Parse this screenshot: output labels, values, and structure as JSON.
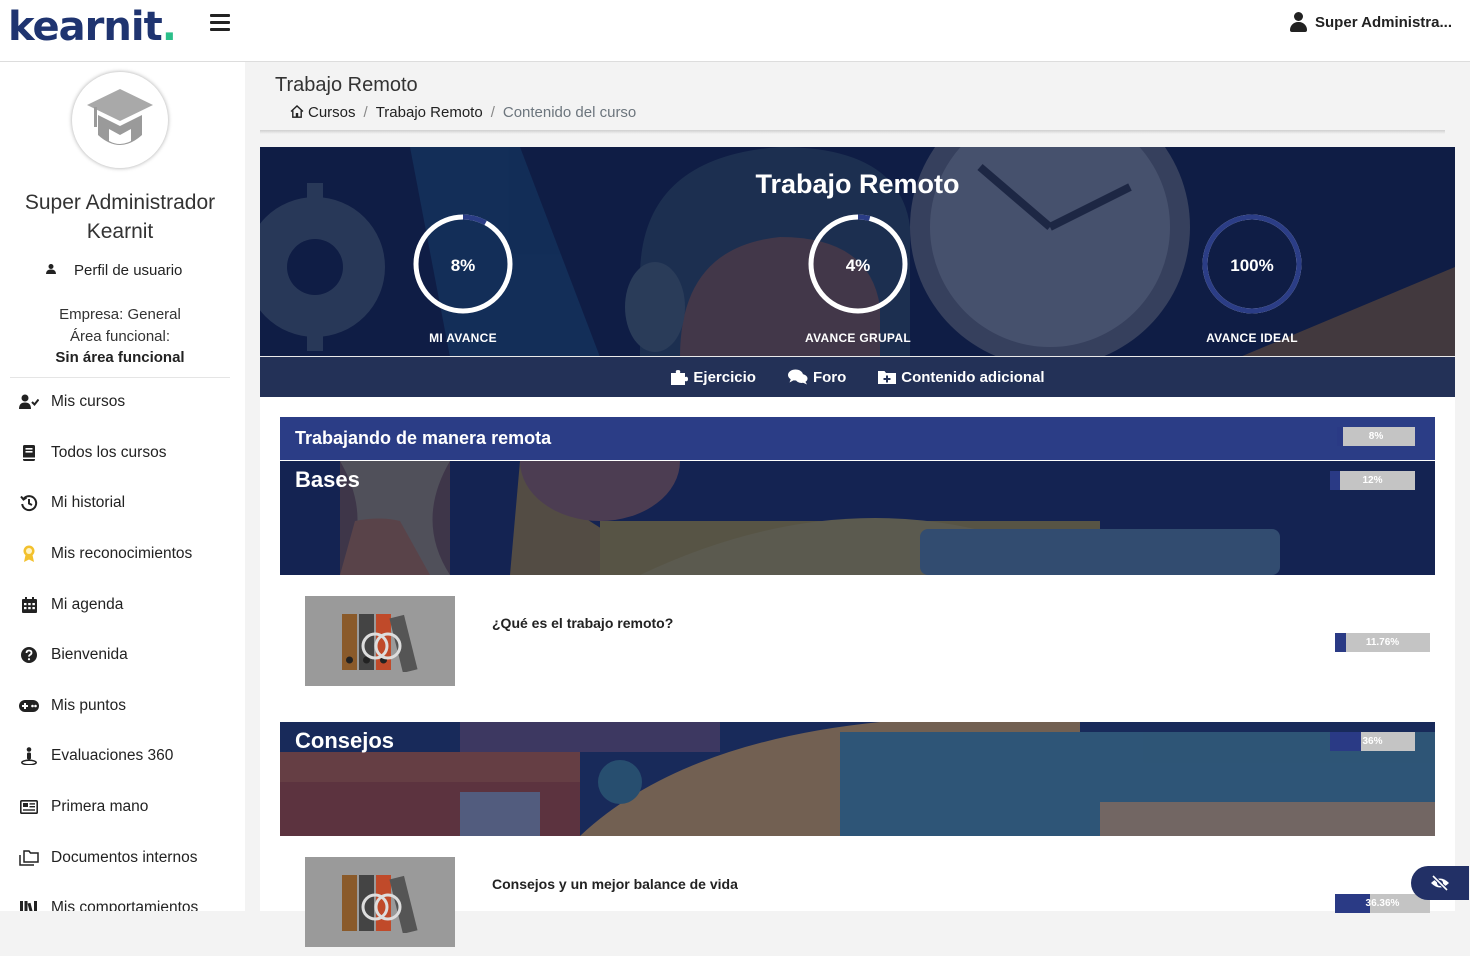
{
  "app": {
    "logo": "kearnit",
    "logo_dot": "."
  },
  "header": {
    "user_name": "Super Administra...",
    "user_icon": "user-icon",
    "menu_icon": "hamburger-icon"
  },
  "sidebar": {
    "name_line1": "Super Administrador",
    "name_line2": "Kearnit",
    "profile_link": "Perfil de usuario",
    "empresa": "Empresa: General",
    "area_label": "Área funcional:",
    "area_value": "Sin área funcional",
    "items": [
      {
        "label": "Mis cursos",
        "icon": "user-check-icon"
      },
      {
        "label": "Todos los cursos",
        "icon": "book-icon"
      },
      {
        "label": "Mi historial",
        "icon": "history-icon"
      },
      {
        "label": "Mis reconocimientos",
        "icon": "award-icon"
      },
      {
        "label": "Mi agenda",
        "icon": "calendar-icon"
      },
      {
        "label": "Bienvenida",
        "icon": "question-circle-icon"
      },
      {
        "label": "Mis puntos",
        "icon": "gamepad-icon"
      },
      {
        "label": "Evaluaciones 360",
        "icon": "person-pin-icon"
      },
      {
        "label": "Primera mano",
        "icon": "newspaper-icon"
      },
      {
        "label": "Documentos internos",
        "icon": "folders-icon"
      },
      {
        "label": "Mis comportamientos",
        "icon": "books-icon"
      }
    ]
  },
  "page": {
    "title": "Trabajo Remoto",
    "breadcrumb": {
      "home": "Cursos",
      "course": "Trabajo Remoto",
      "current": "Contenido del curso",
      "sep": "/"
    }
  },
  "banner": {
    "title": "Trabajo Remoto",
    "rings": [
      {
        "value": "8%",
        "label": "MI AVANCE",
        "progress": 0.08
      },
      {
        "value": "4%",
        "label": "AVANCE GRUPAL",
        "progress": 0.04
      },
      {
        "value": "100%",
        "label": "AVANCE IDEAL",
        "progress": 1.0
      }
    ],
    "tabs": [
      {
        "label": "Ejercicio",
        "icon": "puzzle-icon"
      },
      {
        "label": "Foro",
        "icon": "comments-icon"
      },
      {
        "label": "Contenido adicional",
        "icon": "folder-plus-icon"
      }
    ]
  },
  "module": {
    "title": "Trabajando de manera remota",
    "progress_text": "8%",
    "progress": 0.08
  },
  "sections": [
    {
      "title": "Bases",
      "progress_text": "12%",
      "progress": 0.12,
      "lesson": {
        "title": "¿Qué es el trabajo remoto?",
        "progress_text": "11.76%",
        "progress": 0.1176
      }
    },
    {
      "title": "Consejos",
      "progress_text": "36%",
      "progress": 0.36,
      "lesson": {
        "title": "Consejos y un mejor balance de vida",
        "progress_text": "36.36%",
        "progress": 0.3636
      }
    }
  ],
  "colors": {
    "brand": "#1f3470",
    "accent": "#2bbf8a",
    "banner_bg": "#0f1d45",
    "module_bg": "#2b3d86",
    "bar_fill": "#2a3a85",
    "bar_track": "#c4c4c4"
  },
  "float_button": {
    "icon": "eye-slash-icon"
  }
}
